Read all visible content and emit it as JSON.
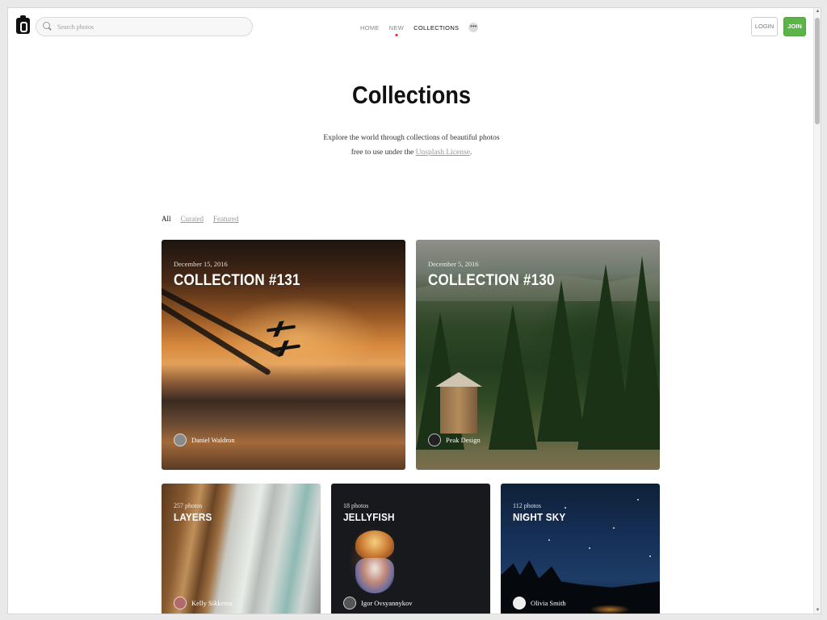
{
  "header": {
    "search_placeholder": "Search photos",
    "nav": {
      "home": "HOME",
      "new": "NEW",
      "collections": "COLLECTIONS",
      "more": "•••"
    },
    "login": "LOGIN",
    "join": "JOIN"
  },
  "hero": {
    "title": "Collections",
    "subtitle_line1": "Explore the world through collections of beautiful photos",
    "subtitle_line2_prefix": "free to use under the ",
    "license_link": "Unsplash License",
    "subtitle_line2_suffix": "."
  },
  "filters": {
    "all": "All",
    "curated": "Curated",
    "featured": "Featured"
  },
  "featured_cards": [
    {
      "date": "December 15, 2016",
      "title": "COLLECTION #131",
      "author": "Daniel Waldron"
    },
    {
      "date": "December 5, 2016",
      "title": "COLLECTION #130",
      "author": "Peak Design"
    }
  ],
  "collection_cards": [
    {
      "count": "257 photos",
      "title": "LAYERS",
      "author": "Kelly Sikkema"
    },
    {
      "count": "18 photos",
      "title": "JELLYFISH",
      "author": "Igor Ovsyannykov"
    },
    {
      "count": "112 photos",
      "title": "NIGHT SKY",
      "author": "Olivia Smith"
    }
  ],
  "colors": {
    "accent_join": "#5ab448",
    "new_dot": "#e52020"
  }
}
